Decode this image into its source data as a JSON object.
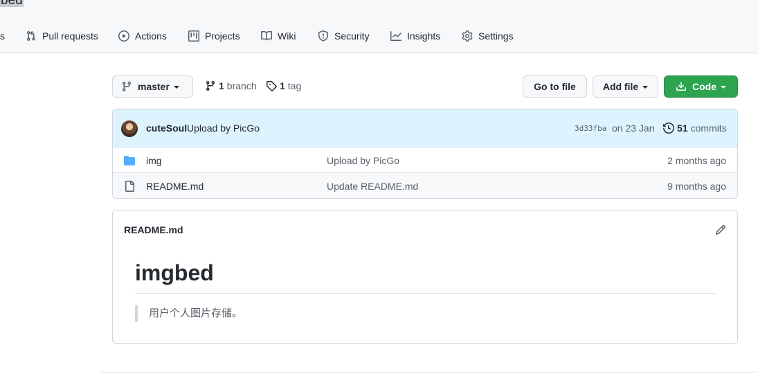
{
  "repo": {
    "name_fragment": "bed"
  },
  "tabs": {
    "fragment": "s",
    "pull_requests": "Pull requests",
    "actions": "Actions",
    "projects": "Projects",
    "wiki": "Wiki",
    "security": "Security",
    "insights": "Insights",
    "settings": "Settings"
  },
  "file_nav": {
    "branch_name": "master",
    "branch_count": "1",
    "branch_label": "branch",
    "tag_count": "1",
    "tag_label": "tag",
    "go_to_file": "Go to file",
    "add_file": "Add file",
    "code": "Code"
  },
  "latest_commit": {
    "author": "cuteSoul",
    "message": "Upload by PicGo",
    "sha": "3d33fba",
    "date": "on 23 Jan",
    "commit_count": "51",
    "commit_label": "commits"
  },
  "files": [
    {
      "name": "img",
      "type": "folder",
      "commit": "Upload by PicGo",
      "age": "2 months ago"
    },
    {
      "name": "README.md",
      "type": "file",
      "commit": "Update README.md",
      "age": "9 months ago"
    }
  ],
  "readme": {
    "filename": "README.md",
    "heading": "imgbed",
    "quote": "用户个人图片存储。"
  },
  "colors": {
    "primary_button": "#2da44e",
    "commit_bar_bg": "#ddf4ff",
    "folder_icon": "#54aeff"
  }
}
